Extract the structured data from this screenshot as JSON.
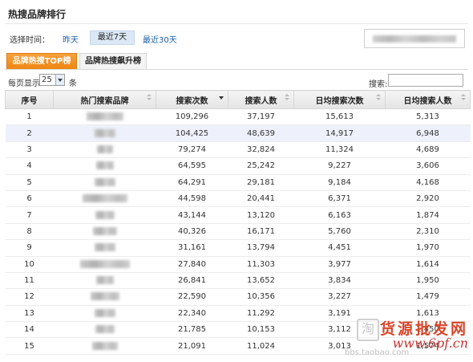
{
  "page": {
    "title": "热搜品牌排行"
  },
  "time_filter": {
    "label": "选择时间：",
    "options": [
      "昨天",
      "最近7天",
      "最近30天"
    ],
    "active": "最近7天"
  },
  "tabs": [
    {
      "label": "品牌热搜TOP榜",
      "active": true
    },
    {
      "label": "品牌热搜飙升榜",
      "active": false
    }
  ],
  "controls": {
    "per_page_label": "每页显示",
    "per_page_value": "25",
    "per_page_unit": "条",
    "search_label": "搜索:",
    "search_value": ""
  },
  "table": {
    "columns": [
      "序号",
      "热门搜索品牌",
      "搜索次数",
      "搜索人数",
      "日均搜索次数",
      "日均搜索人数"
    ],
    "rows": [
      {
        "rank": "1",
        "searches": "109,296",
        "searchers": "37,197",
        "avg_searches": "15,613",
        "avg_searchers": "5,313"
      },
      {
        "rank": "2",
        "searches": "104,425",
        "searchers": "48,639",
        "avg_searches": "14,917",
        "avg_searchers": "6,948"
      },
      {
        "rank": "3",
        "searches": "79,274",
        "searchers": "32,824",
        "avg_searches": "11,324",
        "avg_searchers": "4,689"
      },
      {
        "rank": "4",
        "searches": "64,595",
        "searchers": "25,242",
        "avg_searches": "9,227",
        "avg_searchers": "3,606"
      },
      {
        "rank": "5",
        "searches": "64,291",
        "searchers": "29,181",
        "avg_searches": "9,184",
        "avg_searchers": "4,168"
      },
      {
        "rank": "6",
        "searches": "44,598",
        "searchers": "20,441",
        "avg_searches": "6,371",
        "avg_searchers": "2,920"
      },
      {
        "rank": "7",
        "searches": "43,144",
        "searchers": "13,120",
        "avg_searches": "6,163",
        "avg_searchers": "1,874"
      },
      {
        "rank": "8",
        "searches": "40,326",
        "searchers": "16,171",
        "avg_searches": "5,760",
        "avg_searchers": "2,310"
      },
      {
        "rank": "9",
        "searches": "31,161",
        "searchers": "13,794",
        "avg_searches": "4,451",
        "avg_searchers": "1,970"
      },
      {
        "rank": "10",
        "searches": "27,840",
        "searchers": "11,303",
        "avg_searches": "3,977",
        "avg_searchers": "1,614"
      },
      {
        "rank": "11",
        "searches": "26,841",
        "searchers": "13,652",
        "avg_searches": "3,834",
        "avg_searchers": "1,950"
      },
      {
        "rank": "12",
        "searches": "22,590",
        "searchers": "10,356",
        "avg_searches": "3,227",
        "avg_searchers": "1,479"
      },
      {
        "rank": "13",
        "searches": "22,340",
        "searchers": "11,292",
        "avg_searches": "3,191",
        "avg_searchers": "1,613"
      },
      {
        "rank": "14",
        "searches": "21,785",
        "searchers": "10,153",
        "avg_searches": "3,112",
        "avg_searchers": "1,450"
      },
      {
        "rank": "15",
        "searches": "21,091",
        "searchers": "11,024",
        "avg_searches": "3,013",
        "avg_searchers": "1,574"
      }
    ]
  },
  "watermark": {
    "line1": "货源批发网",
    "line2": "www.6pf.cn",
    "line3": "bbs.taobao.com",
    "glyph": "淘"
  },
  "colors": {
    "tab_active": "#ee8612",
    "link": "#1f5fa8",
    "highlight_row": "#eef1fb"
  }
}
